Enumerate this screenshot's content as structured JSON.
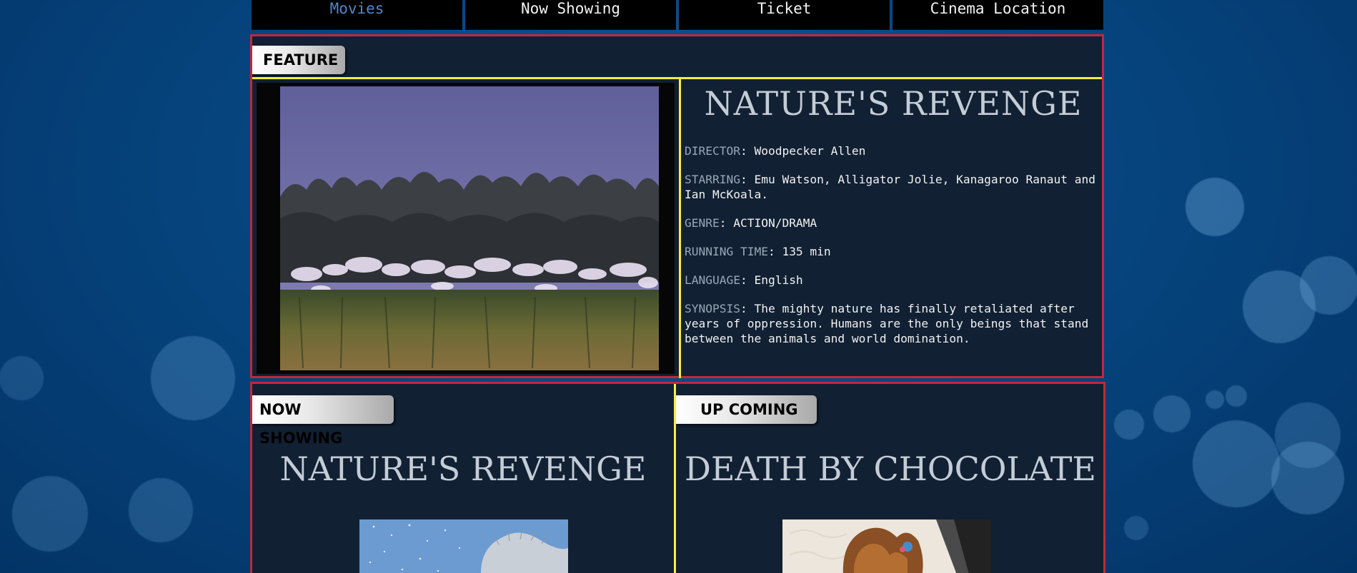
{
  "nav": {
    "items": [
      {
        "label": "Movies",
        "active": true
      },
      {
        "label": "Now Showing",
        "active": false
      },
      {
        "label": "Ticket",
        "active": false
      },
      {
        "label": "Cinema Location",
        "active": false
      }
    ]
  },
  "feature": {
    "tab_label": "FEATURE",
    "title": "NATURE'S REVENGE",
    "details": {
      "director": {
        "key": "DIRECTOR",
        "value": ": Woodpecker Allen"
      },
      "starring": {
        "key": "STARRING",
        "value": ": Emu Watson, Alligator Jolie, Kanagaroo Ranaut and Ian McKoala."
      },
      "genre": {
        "key": "GENRE",
        "value": ": ACTION/DRAMA"
      },
      "running_time": {
        "key": "RUNNING TIME",
        "value": ": 135 min"
      },
      "language": {
        "key": "LANGUAGE",
        "value": ": English"
      },
      "synopsis": {
        "key": "SYNOPSIS",
        "value": ": The mighty nature has finally retaliated after years of oppression. Humans are the only beings that stand between the animals and world domination."
      }
    }
  },
  "now_showing": {
    "tab_label": "NOW SHOWING",
    "title": "NATURE'S REVENGE"
  },
  "up_coming": {
    "tab_label": "UP COMING",
    "title": "DEATH BY CHOCOLATE"
  },
  "colors": {
    "panel_border": "#c4273a",
    "divider": "#ffec3a",
    "active_nav": "#4f86c9",
    "panel_bg": "#112033"
  }
}
